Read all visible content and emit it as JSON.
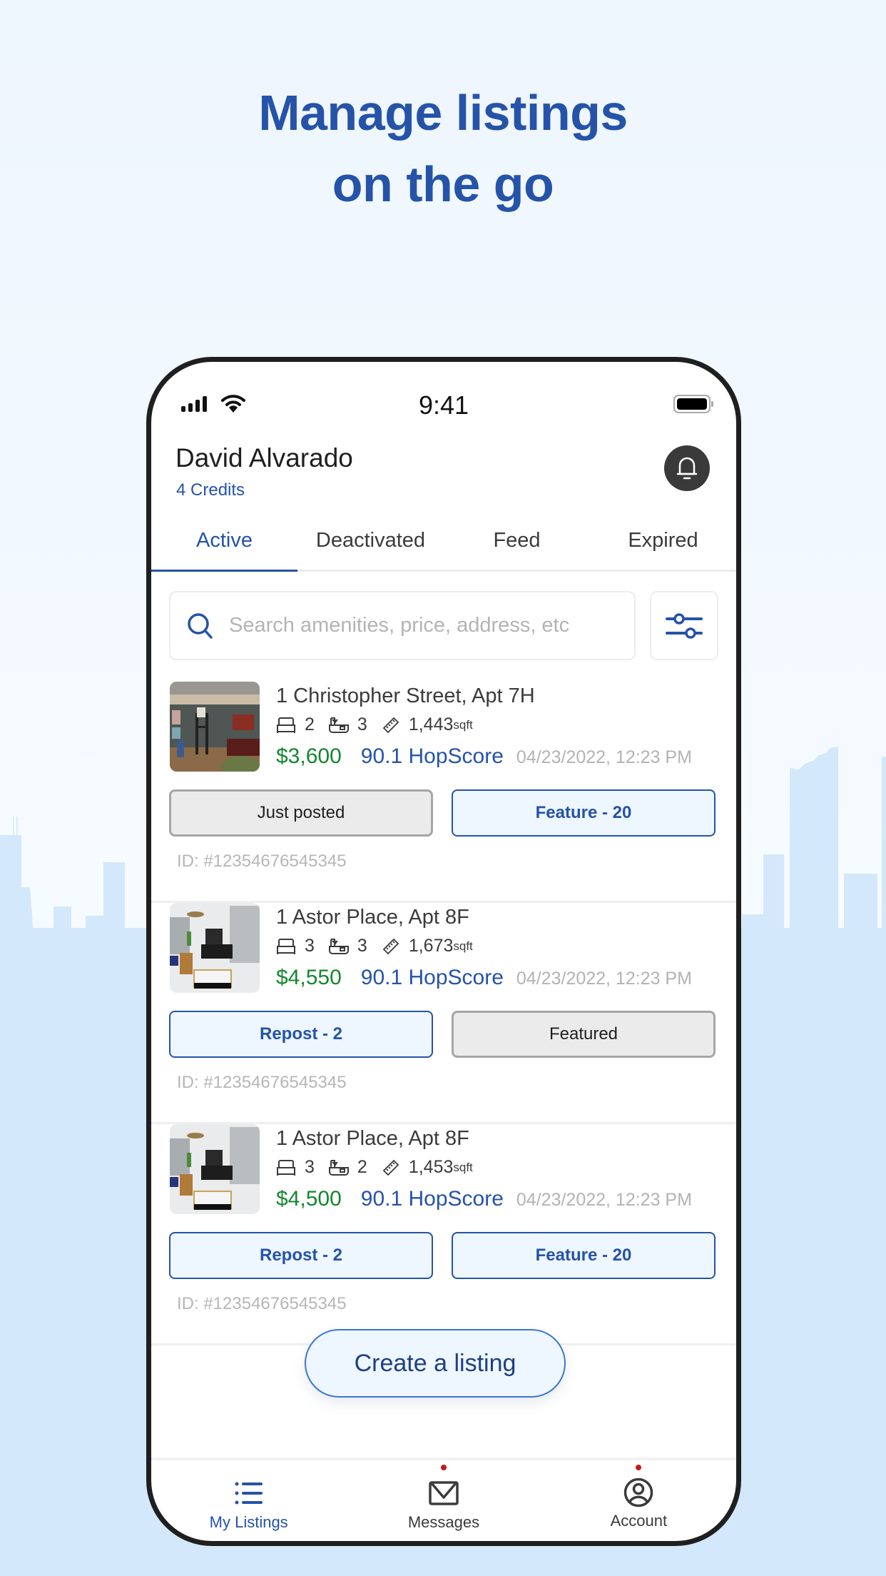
{
  "headline": {
    "line1": "Manage listings",
    "line2": "on the go"
  },
  "colors": {
    "brand": "#2553a8",
    "price": "#15872e",
    "alert_dot": "#c9171e",
    "skyline": "#d3e8fb"
  },
  "status_bar": {
    "time": "9:41",
    "icons": [
      "signal-icon",
      "wifi-icon",
      "battery-icon"
    ]
  },
  "header": {
    "user_name": "David Alvarado",
    "credits": "4 Credits",
    "bell_icon": "bell-icon"
  },
  "tabs": [
    {
      "label": "Active",
      "active": true
    },
    {
      "label": "Deactivated",
      "active": false
    },
    {
      "label": "Feed",
      "active": false
    },
    {
      "label": "Expired",
      "active": false
    }
  ],
  "search": {
    "placeholder": "Search amenities, price, address, etc",
    "value": "",
    "icon": "search-icon",
    "filter_icon": "sliders-icon"
  },
  "listings": [
    {
      "address": "1 Christopher Street, Apt 7H",
      "beds": "2",
      "baths": "3",
      "sqft": "1,443",
      "sqft_unit": "sqft",
      "price": "$3,600",
      "hopscore": "90.1 HopScore",
      "date": "04/23/2022, 12:23 PM",
      "left_button": {
        "label": "Just posted",
        "style": "gray"
      },
      "right_button": {
        "label": "Feature - 20",
        "style": "blue"
      },
      "id_text": "ID: #12354676545345",
      "photo": "dark-green-living-room"
    },
    {
      "address": "1 Astor Place, Apt 8F",
      "beds": "3",
      "baths": "3",
      "sqft": "1,673",
      "sqft_unit": "sqft",
      "price": "$4,550",
      "hopscore": "90.1 HopScore",
      "date": "04/23/2022, 12:23 PM",
      "left_button": {
        "label": "Repost - 2",
        "style": "blue"
      },
      "right_button": {
        "label": "Featured",
        "style": "gray"
      },
      "id_text": "ID: #12354676545345",
      "photo": "bright-living-room"
    },
    {
      "address": "1 Astor Place, Apt 8F",
      "beds": "3",
      "baths": "2",
      "sqft": "1,453",
      "sqft_unit": "sqft",
      "price": "$4,500",
      "hopscore": "90.1 HopScore",
      "date": "04/23/2022, 12:23 PM",
      "left_button": {
        "label": "Repost - 2",
        "style": "blue"
      },
      "right_button": {
        "label": "Feature - 20",
        "style": "blue"
      },
      "id_text": "ID: #12354676545345",
      "photo": "bright-living-room"
    }
  ],
  "create_button": {
    "label": "Create a listing"
  },
  "bottom_nav": [
    {
      "label": "My Listings",
      "icon": "list-icon",
      "active": true,
      "badge": false
    },
    {
      "label": "Messages",
      "icon": "envelope-icon",
      "active": false,
      "badge": true
    },
    {
      "label": "Account",
      "icon": "user-circle-icon",
      "active": false,
      "badge": true
    }
  ]
}
